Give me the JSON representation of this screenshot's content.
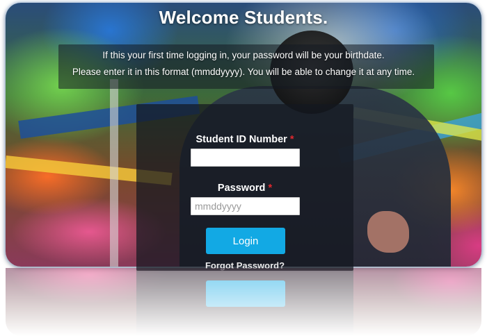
{
  "page": {
    "title": "Welcome Students.",
    "info_line_1": "If this your first time logging in, your password will be your birthdate.",
    "info_line_2": "Please enter it in this format (mmddyyyy). You will be able to change it at any time."
  },
  "form": {
    "student_id_label": "Student ID Number",
    "student_id_value": "",
    "password_label": "Password",
    "password_placeholder": "mmddyyyy",
    "password_value": "",
    "required_marker": "*",
    "login_label": "Login",
    "forgot_label": "Forgot Password?"
  },
  "colors": {
    "accent": "#12a9e4",
    "required": "#e0282e",
    "panel": "#141820"
  }
}
